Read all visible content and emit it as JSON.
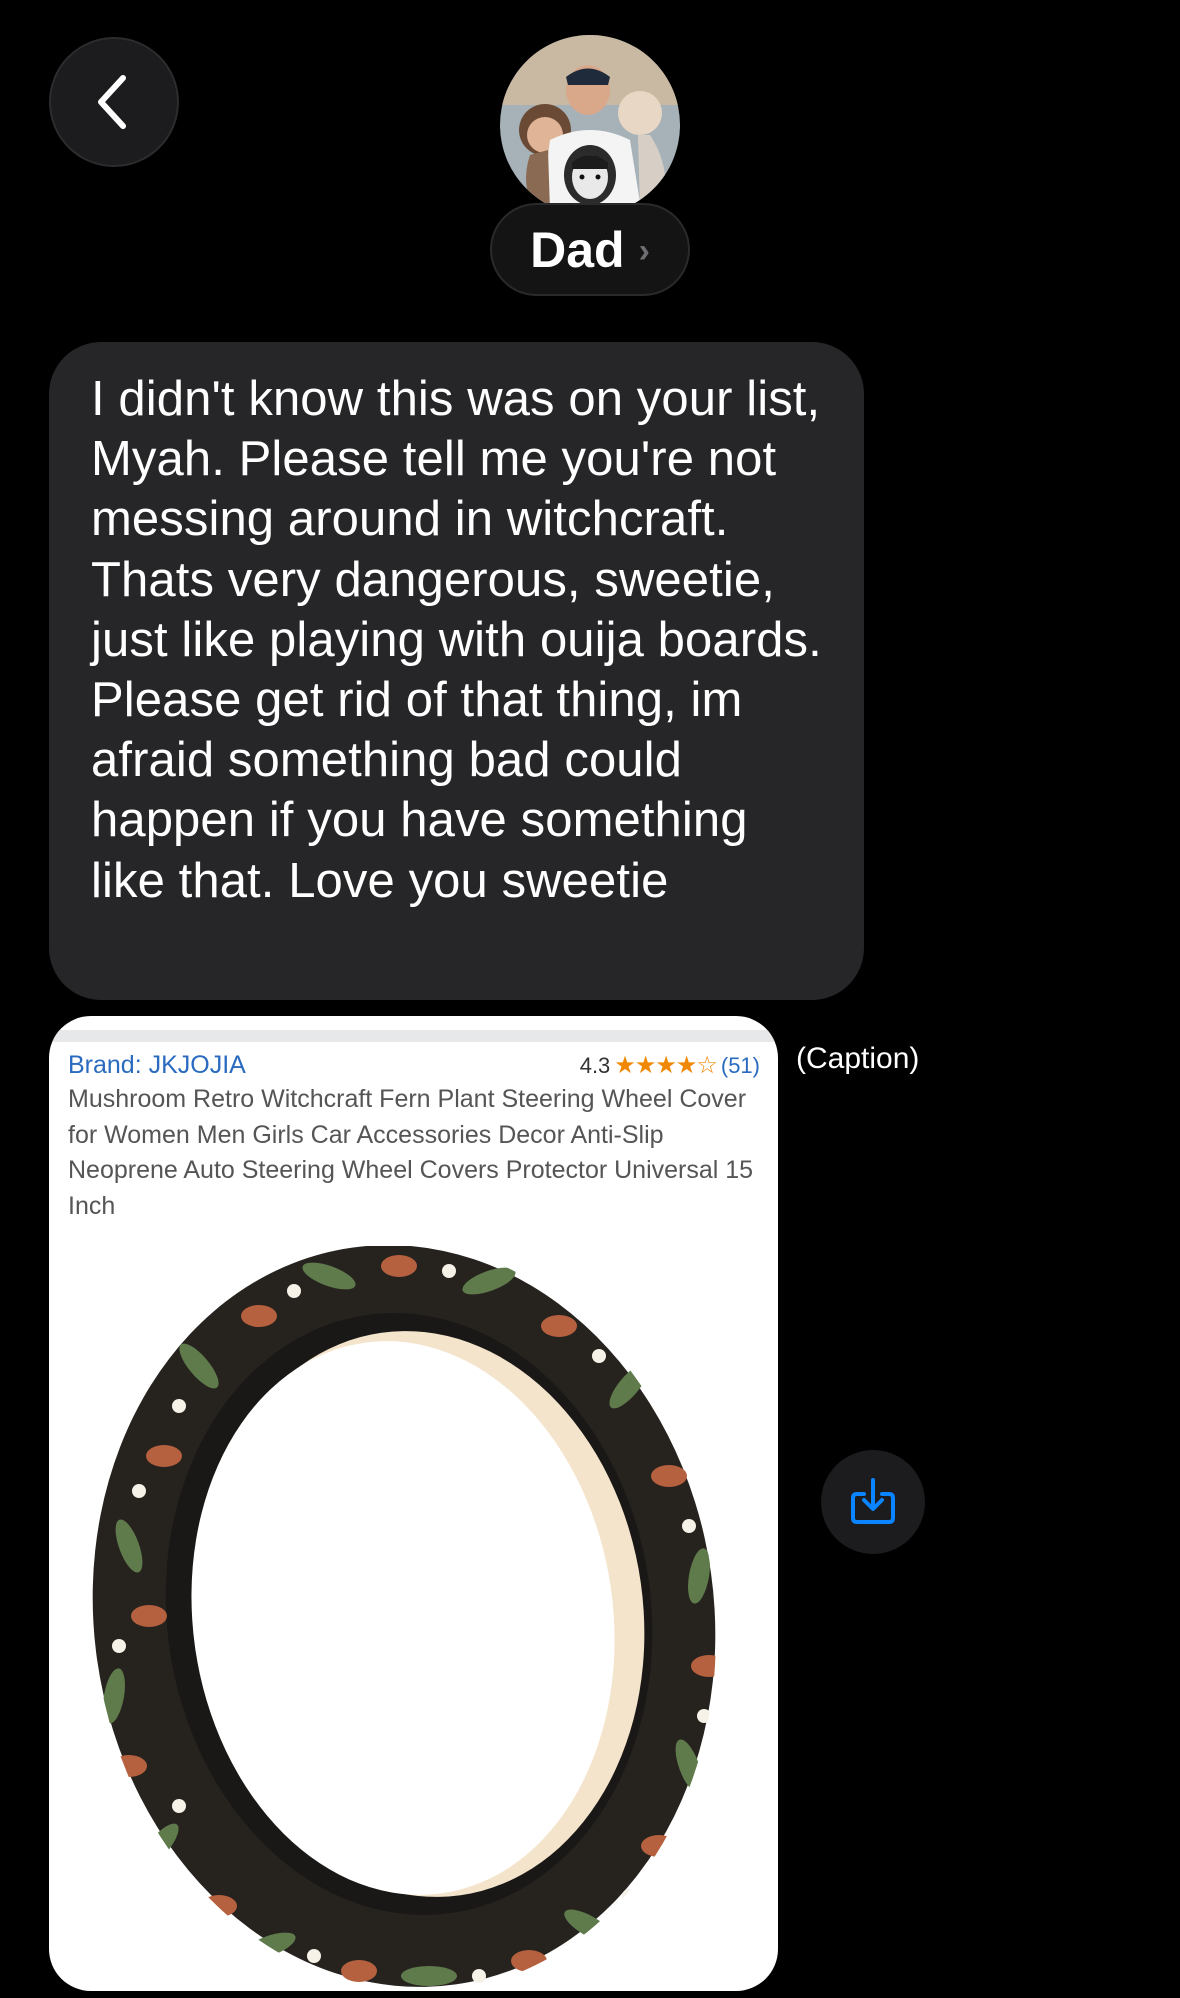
{
  "header": {
    "contact_name": "Dad",
    "chevron": "›",
    "back_icon": "chevron-left-icon",
    "avatar": "contact-photo"
  },
  "message": {
    "text": "I didn't know this was on your list, Myah.  Please tell me you're not messing around in witchcraft.  Thats very dangerous, sweetie, just like playing with ouija boards.  Please get rid of that thing, im afraid something bad could happen if you have something like that.  Love you sweetie"
  },
  "product": {
    "brand": "Brand: JKJOJIA",
    "rating": "4.3",
    "stars": "★★★★☆",
    "review_count": "(51)",
    "title": "Mushroom Retro Witchcraft Fern Plant Steering Wheel Cover for Women Men Girls Car Accessories Decor Anti-Slip Neoprene Auto Steering Wheel Covers Protector Universal 15 Inch"
  },
  "caption": "(Caption)",
  "save_icon": "save-download-icon",
  "colors": {
    "background": "#000000",
    "bubble": "#262628",
    "link_blue": "#2a6bbf",
    "star_orange": "#f08804",
    "icon_blue": "#0a84ff"
  }
}
